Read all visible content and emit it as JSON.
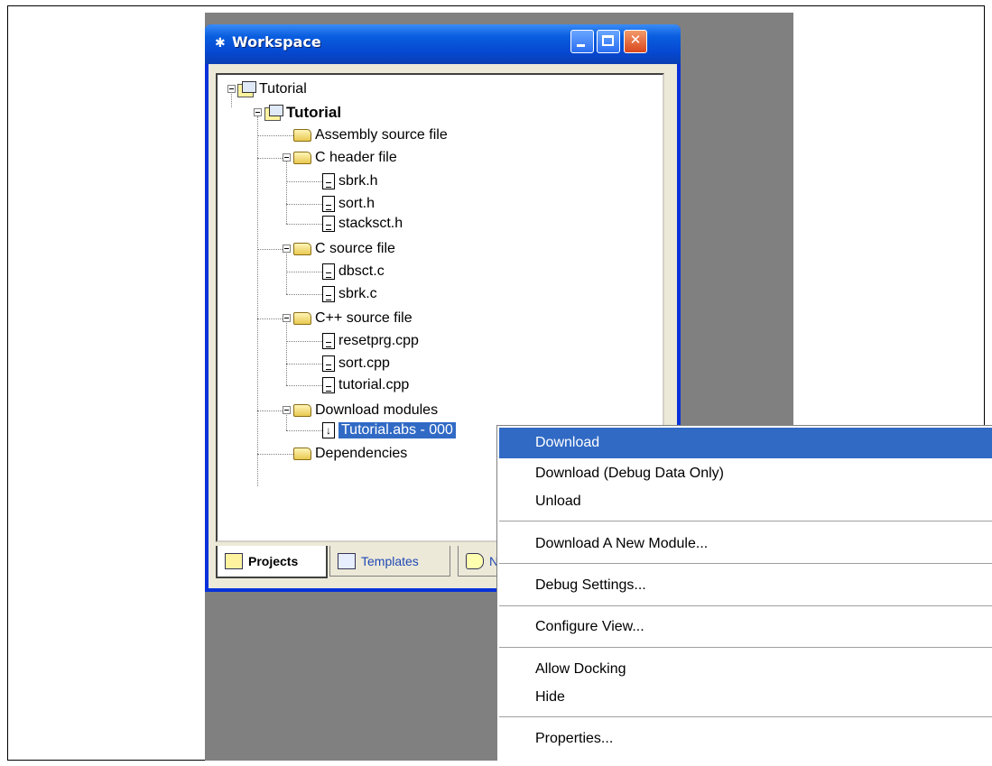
{
  "window": {
    "title": "Workspace",
    "title_icon": "workspace-icon",
    "controls": [
      "minimize",
      "maximize",
      "close"
    ]
  },
  "tree": {
    "workspace": "Tutorial",
    "project": "Tutorial",
    "folders": [
      {
        "label": "Assembly source file",
        "children": []
      },
      {
        "label": "C header file",
        "children": [
          "sbrk.h",
          "sort.h",
          "stacksct.h"
        ]
      },
      {
        "label": "C source file",
        "children": [
          "dbsct.c",
          "sbrk.c"
        ]
      },
      {
        "label": "C++ source file",
        "children": [
          "resetprg.cpp",
          "sort.cpp",
          "tutorial.cpp"
        ]
      },
      {
        "label": "Download modules",
        "children": [
          "Tutorial.abs - 000"
        ]
      },
      {
        "label": "Dependencies",
        "children": []
      }
    ],
    "selected": "Tutorial.abs - 000"
  },
  "tabs": [
    {
      "label": "Projects",
      "icon": "projects-icon",
      "active": true
    },
    {
      "label": "Templates",
      "icon": "templates-icon",
      "active": false
    },
    {
      "label": "N",
      "icon": "navigation-icon",
      "active": false
    }
  ],
  "context_menu": {
    "items": [
      {
        "label": "Download",
        "highlighted": true
      },
      {
        "label": "Download (Debug Data Only)"
      },
      {
        "label": "Unload"
      },
      {
        "label": "Download A New Module..."
      },
      {
        "label": "Debug Settings..."
      },
      {
        "label": "Configure View..."
      },
      {
        "label": "Allow Docking"
      },
      {
        "label": "Hide"
      },
      {
        "label": "Properties..."
      }
    ]
  },
  "colors": {
    "titlebar": "#0a5ee0",
    "selection": "#316ac5",
    "desktop": "#808080"
  }
}
